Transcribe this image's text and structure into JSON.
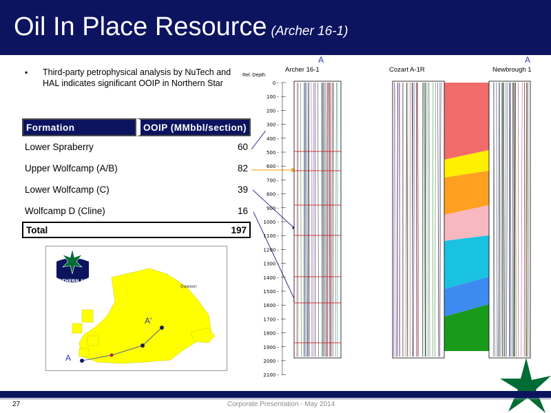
{
  "header": {
    "title": "Oil In Place Resource",
    "subtitle": "(Archer 16-1)"
  },
  "bullet": {
    "marker": "▪",
    "text": "Third-party petrophysical analysis by NuTech  and HAL indicates significant OOIP in Northern Star"
  },
  "table": {
    "headers": [
      "Formation",
      "OOIP (MMbbl/section)"
    ],
    "rows": [
      {
        "formation": "Lower Spraberry",
        "ooip": "60"
      },
      {
        "formation": "Upper Wolfcamp (A/B)",
        "ooip": "82"
      },
      {
        "formation": "Lower Wolfcamp (C)",
        "ooip": "39"
      },
      {
        "formation": "Wolfcamp D (Cline)",
        "ooip": "16"
      }
    ],
    "total": {
      "label": "Total",
      "value": "197"
    }
  },
  "map": {
    "logo_text": "NORTHERN STAR",
    "county_label": "Dawson",
    "a_label": "A",
    "a_prime_label": "A'"
  },
  "cross_section": {
    "a_left": "A",
    "a_right": "A",
    "wells": [
      "Archer 16-1",
      "Cozart A-1R",
      "Newbrough 1"
    ],
    "depth_title": "Rel. Depth",
    "depth_ticks": [
      "0",
      "100",
      "200",
      "300",
      "400",
      "500",
      "600",
      "700",
      "800",
      "900",
      "1000",
      "1100",
      "1200",
      "1300",
      "1400",
      "1500",
      "1600",
      "1700",
      "1800",
      "1900",
      "2000",
      "2100"
    ],
    "band_colors": [
      "#f26b6b",
      "#fff000",
      "#ffa020",
      "#f7b8bf",
      "#19c2e0",
      "#3d8bf0",
      "#1a9a1a"
    ],
    "arrow_color": "#2b2f8a",
    "highlight_arrow_color": "#f0b030"
  },
  "footer": {
    "page": "27",
    "text": "Corporate Presentation - May 2014"
  },
  "colors": {
    "navy": "#0c1460",
    "star_green": "#006c35",
    "map_yellow": "#ffff00"
  }
}
